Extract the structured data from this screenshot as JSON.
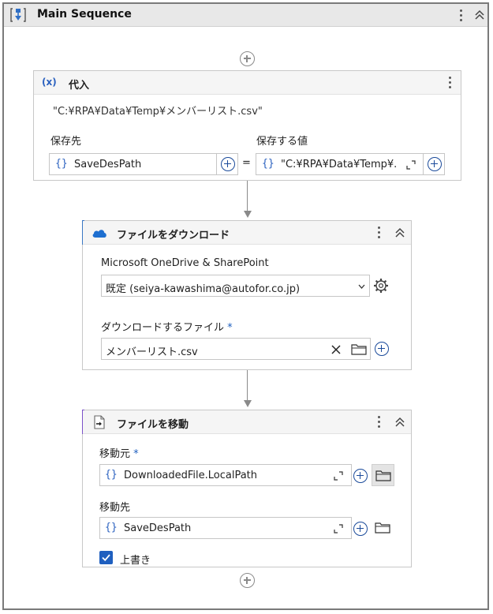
{
  "main": {
    "title": "Main Sequence"
  },
  "assign": {
    "title": "代入",
    "expression": "\"C:¥RPA¥Data¥Temp¥メンバーリスト.csv\"",
    "to_label": "保存先",
    "to_value": "SaveDesPath",
    "equals": "=",
    "value_label": "保存する値",
    "value_value": "\"C:¥RPA¥Data¥Temp¥."
  },
  "download": {
    "title": "ファイルをダウンロード",
    "service_label": "Microsoft OneDrive & SharePoint",
    "account_value": "既定 (seiya-kawashima@autofor.co.jp)",
    "file_label": "ダウンロードするファイル",
    "required_mark": "*",
    "file_value": "メンバーリスト.csv"
  },
  "move": {
    "title": "ファイルを移動",
    "source_label": "移動元",
    "required_mark": "*",
    "source_value": "DownloadedFile.LocalPath",
    "dest_label": "移動先",
    "dest_value": "SaveDesPath",
    "overwrite_label": "上書き",
    "overwrite_checked": true
  },
  "icons": {
    "variable": "{}",
    "assign": "(x)",
    "onedrive": "cloud-icon",
    "move": "file-move-icon"
  },
  "colors": {
    "accent_blue": "#3b78c4",
    "accent_purple": "#7b52c9",
    "brace_blue": "#2c62c0",
    "checkbox_blue": "#1f5fbf"
  }
}
